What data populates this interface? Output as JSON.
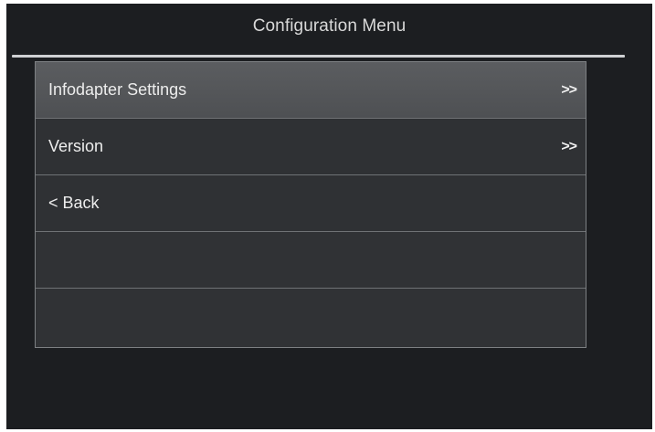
{
  "header": {
    "title": "Configuration Menu"
  },
  "menu": {
    "items": [
      {
        "label": "Infodapter Settings",
        "arrow": ">>"
      },
      {
        "label": "Version",
        "arrow": ">>"
      },
      {
        "label": "< Back",
        "arrow": ""
      },
      {
        "label": "",
        "arrow": ""
      },
      {
        "label": "",
        "arrow": ""
      }
    ],
    "selected_index": 0
  }
}
